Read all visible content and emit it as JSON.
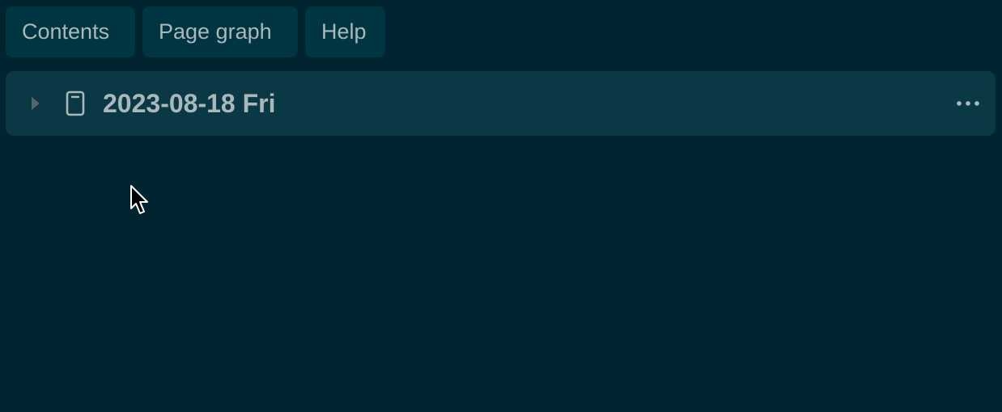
{
  "tabs": {
    "contents": "Contents",
    "page_graph": "Page graph",
    "help": "Help"
  },
  "page_row": {
    "title": "2023-08-18 Fri",
    "expand_icon": "caret-right-icon",
    "page_icon": "page-icon",
    "more_icon": "more-horizontal-icon"
  },
  "colors": {
    "background": "#002430",
    "tab_background": "#003541",
    "row_background": "#0a3845",
    "text": "#a9b8bb"
  }
}
